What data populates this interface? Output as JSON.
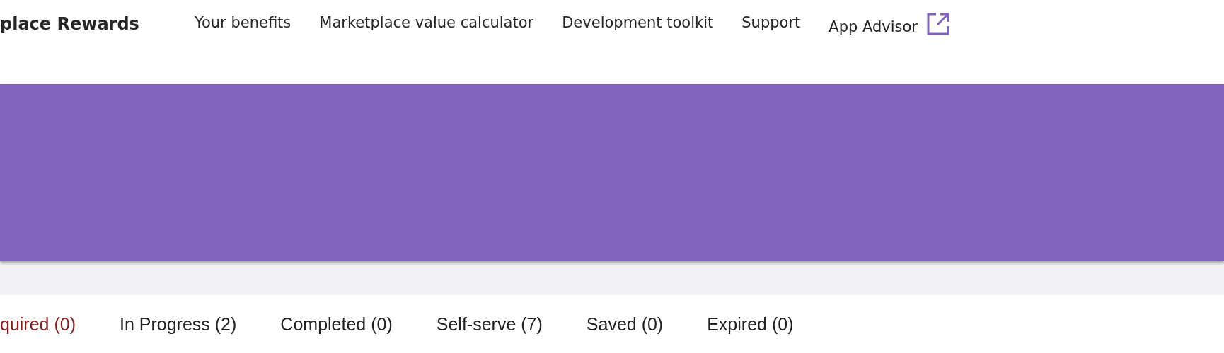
{
  "brand": "place Rewards",
  "nav": [
    {
      "label": "Your benefits",
      "external": false
    },
    {
      "label": "Marketplace value calculator",
      "external": false
    },
    {
      "label": "Development toolkit",
      "external": false
    },
    {
      "label": "Support",
      "external": false
    },
    {
      "label": "App Advisor",
      "external": true
    }
  ],
  "tabs": [
    {
      "label": "quired (0)",
      "selected": true
    },
    {
      "label": "In Progress (2)",
      "selected": false
    },
    {
      "label": "Completed (0)",
      "selected": false
    },
    {
      "label": "Self-serve (7)",
      "selected": false
    },
    {
      "label": "Saved (0)",
      "selected": false
    },
    {
      "label": "Expired (0)",
      "selected": false
    }
  ]
}
